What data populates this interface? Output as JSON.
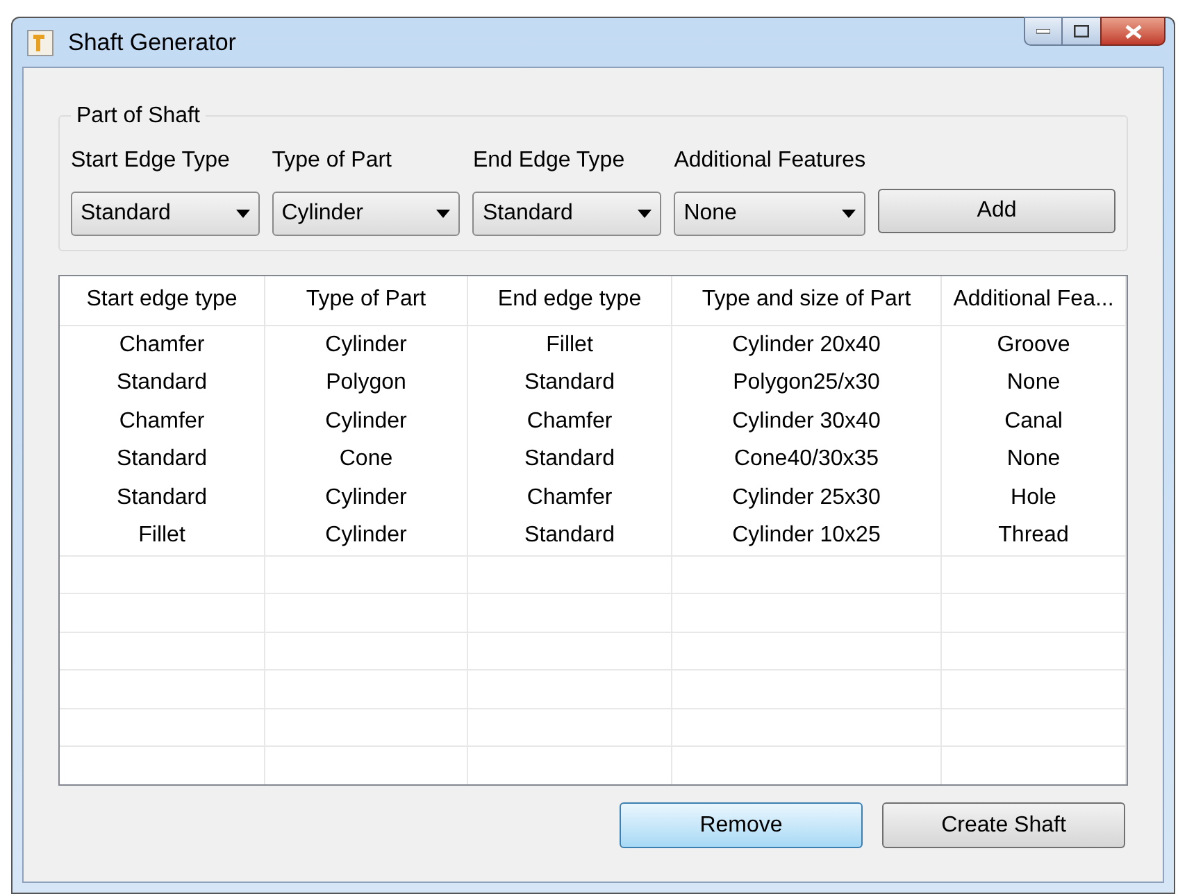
{
  "window": {
    "title": "Shaft Generator"
  },
  "group": {
    "title": "Part of Shaft",
    "fields": [
      {
        "label": "Start Edge Type",
        "value": "Standard"
      },
      {
        "label": "Type of Part",
        "value": "Cylinder"
      },
      {
        "label": "End Edge Type",
        "value": "Standard"
      },
      {
        "label": "Additional Features",
        "value": "None"
      }
    ],
    "add_button": "Add"
  },
  "table": {
    "columns": [
      "Start edge type",
      "Type of Part",
      "End edge type",
      "Type and size of Part",
      "Additional Fea..."
    ],
    "rows": [
      [
        "Chamfer",
        "Cylinder",
        "Fillet",
        "Cylinder 20x40",
        "Groove"
      ],
      [
        "Standard",
        "Polygon",
        "Standard",
        "Polygon25/x30",
        "None"
      ],
      [
        "Chamfer",
        "Cylinder",
        "Chamfer",
        "Cylinder 30x40",
        "Canal"
      ],
      [
        "Standard",
        "Cone",
        "Standard",
        "Cone40/30x35",
        "None"
      ],
      [
        "Standard",
        "Cylinder",
        "Chamfer",
        "Cylinder 25x30",
        "Hole"
      ],
      [
        "Fillet",
        "Cylinder",
        "Standard",
        "Cylinder 10x25",
        "Thread"
      ]
    ]
  },
  "buttons": [
    {
      "label": "Remove",
      "focused": true
    },
    {
      "label": "Create Shaft",
      "focused": false
    }
  ]
}
